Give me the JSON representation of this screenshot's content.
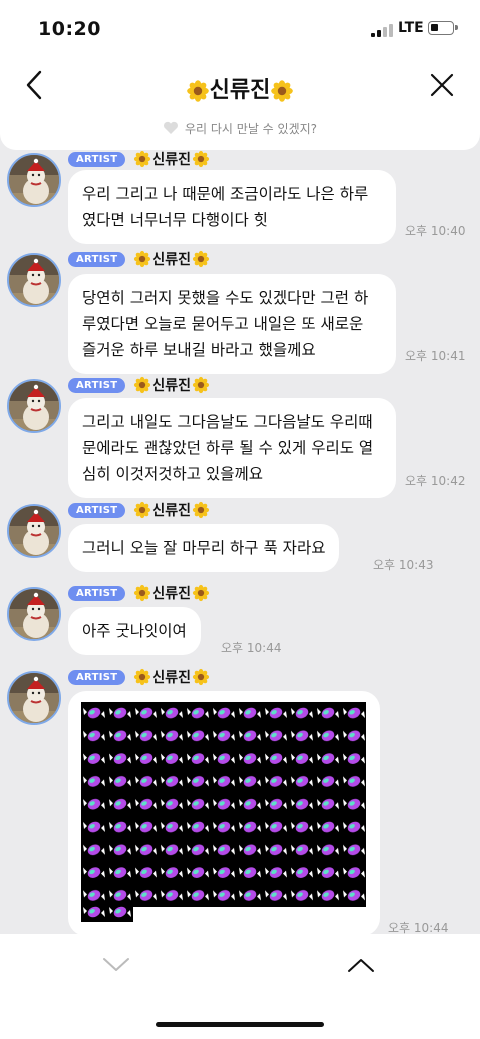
{
  "status": {
    "time": "10:20",
    "network": "LTE"
  },
  "header": {
    "title": "신류진",
    "subtitle": "우리 다시 만날 수 있겠지?"
  },
  "messages": [
    {
      "badge": "ARTIST",
      "sender": "신류진",
      "text": "우리 그리고 나 때문에 조금이라도 나은 하루였다면 너무너무 다행이다 힛",
      "time": "오후 10:40"
    },
    {
      "badge": "ARTIST",
      "sender": "신류진",
      "text": "당연히 그러지 못했을 수도 있겠다만 그런 하루였다면 오늘로 묻어두고 내일은 또 새로운 즐거운 하루 보내길 바라고 했을께요",
      "time": "오후 10:41"
    },
    {
      "badge": "ARTIST",
      "sender": "신류진",
      "text": "그리고 내일도 그다음날도 그다음날도 우리때문에라도 괜찮았던 하루 될 수 있게 우리도 열심히 이것저것하고 있을께요",
      "time": "오후 10:42"
    },
    {
      "badge": "ARTIST",
      "sender": "신류진",
      "text": "그러니 오늘 잘 마무리 하구 푹 자라요",
      "time": "오후 10:43"
    },
    {
      "badge": "ARTIST",
      "sender": "신류진",
      "text": "아주 굿나잇이여",
      "time": "오후 10:44"
    },
    {
      "badge": "ARTIST",
      "sender": "신류진",
      "image_icon": "candy-emoji-grid",
      "time": "오후 10:44"
    }
  ],
  "colors": {
    "badge": "#6e8ef0",
    "flower": "#f6c21b",
    "background": "#ebebed"
  }
}
